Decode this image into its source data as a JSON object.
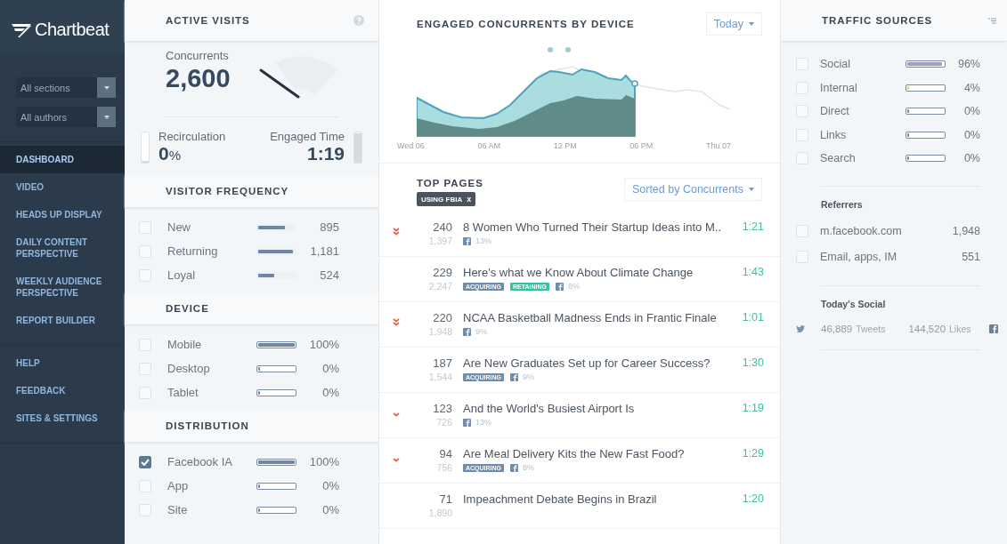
{
  "sidebar": {
    "logo": "Chartbeat",
    "filters": [
      {
        "value": "All sections"
      },
      {
        "value": "All authors"
      }
    ],
    "nav_groups": [
      [
        {
          "label": "DASHBOARD",
          "selected": true
        },
        {
          "label": "VIDEO",
          "selected": false
        },
        {
          "label": "HEADS UP DISPLAY",
          "selected": false
        },
        {
          "label": "DAILY CONTENT PERSPECTIVE",
          "selected": false
        },
        {
          "label": "WEEKLY AUDIENCE PERSPECTIVE",
          "selected": false
        },
        {
          "label": "REPORT BUILDER",
          "selected": false
        }
      ],
      [
        {
          "label": "HELP",
          "selected": false
        },
        {
          "label": "FEEDBACK",
          "selected": false
        },
        {
          "label": "SITES & SETTINGS",
          "selected": false
        }
      ]
    ]
  },
  "active_visits": {
    "title": "ACTIVE VISITS",
    "concurrents_label": "Concurrents",
    "concurrents": "2,600",
    "recirculation_label": "Recirculation",
    "recirculation_value": "0",
    "recirculation_unit": "%",
    "recirculation_meter": {
      "level": 0
    },
    "engaged_time_label": "Engaged Time",
    "engaged_time": "1:19",
    "engaged_meter": {
      "level": 0.95
    }
  },
  "sections": [
    {
      "title": "VISITOR FREQUENCY",
      "kind": "plain",
      "rows": [
        {
          "label": "New",
          "checked": false,
          "level": 0.73,
          "value": "895"
        },
        {
          "label": "Returning",
          "checked": false,
          "level": 0.96,
          "value": "1,181"
        },
        {
          "label": "Loyal",
          "checked": false,
          "level": 0.43,
          "value": "524"
        }
      ]
    },
    {
      "title": "DEVICE",
      "kind": "track",
      "rows": [
        {
          "label": "Mobile",
          "checked": false,
          "level": 1,
          "value": "100%"
        },
        {
          "label": "Desktop",
          "checked": false,
          "level": 0,
          "value": "0%"
        },
        {
          "label": "Tablet",
          "checked": false,
          "level": 0,
          "value": "0%"
        }
      ]
    },
    {
      "title": "DISTRIBUTION",
      "kind": "track",
      "rows": [
        {
          "label": "Facebook IA",
          "checked": true,
          "level": 1,
          "value": "100%"
        },
        {
          "label": "App",
          "checked": false,
          "level": 0,
          "value": "0%"
        },
        {
          "label": "Site",
          "checked": false,
          "level": 0,
          "value": "0%"
        }
      ]
    }
  ],
  "engaged_chart": {
    "title": "ENGAGED CONCURRENTS BY DEVICE",
    "range": "Today",
    "x_labels": [
      "Wed 06",
      "06 AM",
      "12 PM",
      "06 PM",
      "Thu 07"
    ]
  },
  "top_pages": {
    "title": "TOP PAGES",
    "sort": "Sorted by Concurrents",
    "filter_chip": "USING FBIA",
    "chip_close": "x",
    "rows": [
      {
        "kind": "double-down",
        "concurrents": "240",
        "total": "1,397",
        "title": "8 Women Who Turned Their Startup Ideas into M..",
        "tags": [],
        "facebook": "13%",
        "time": "1:21"
      },
      {
        "kind": "plain",
        "concurrents": "229",
        "total": "2,247",
        "title": "Here's what we Know About Climate Change",
        "tags": [
          {
            "label": "ACQUIRING",
            "kind": "acquiring"
          },
          {
            "label": "RETAINING",
            "kind": "retaining"
          }
        ],
        "facebook": "8%",
        "time": "1:43"
      },
      {
        "kind": "double-down",
        "concurrents": "220",
        "total": "1,948",
        "title": "NCAA Basketball Madness Ends in Frantic Finale",
        "tags": [],
        "facebook": "9%",
        "time": "1:01"
      },
      {
        "kind": "plain",
        "concurrents": "187",
        "total": "1,544",
        "title": "Are New Graduates Set up for Career Success?",
        "tags": [
          {
            "label": "ACQUIRING",
            "kind": "acquiring"
          }
        ],
        "facebook": "9%",
        "time": "1:30"
      },
      {
        "kind": "down",
        "concurrents": "123",
        "total": "726",
        "title": "And the World's Busiest Airport Is",
        "tags": [],
        "facebook": "13%",
        "time": "1:19"
      },
      {
        "kind": "down",
        "concurrents": "94",
        "total": "756",
        "title": "Are Meal Delivery Kits the New Fast Food?",
        "tags": [
          {
            "label": "ACQUIRING",
            "kind": "acquiring"
          }
        ],
        "facebook": "8%",
        "time": "1:29"
      },
      {
        "kind": "plain",
        "concurrents": "71",
        "total": "1,890",
        "title": "Impeachment Debate Begins in Brazil",
        "tags": [],
        "facebook": null,
        "time": "1:20"
      }
    ]
  },
  "traffic_sources": {
    "title": "TRAFFIC SOURCES",
    "rows": [
      {
        "label": "Social",
        "checked": false,
        "level": 0.96,
        "value": "96%",
        "color": "#a09ccc"
      },
      {
        "label": "Internal",
        "checked": false,
        "level": 0.04,
        "value": "4%",
        "color": "#e8c87a"
      },
      {
        "label": "Direct",
        "checked": false,
        "level": 0,
        "value": "0%"
      },
      {
        "label": "Links",
        "checked": false,
        "level": 0,
        "value": "0%"
      },
      {
        "label": "Search",
        "checked": false,
        "level": 0,
        "value": "0%"
      }
    ],
    "referrers_title": "Referrers",
    "referrers": [
      {
        "label": "m.facebook.com",
        "checked": false,
        "value": "1,948"
      },
      {
        "label": "Email, apps, IM",
        "checked": false,
        "value": "551"
      }
    ],
    "social_title": "Today's Social",
    "tweets": "46,889",
    "tweets_label": "Tweets",
    "likes": "144,520",
    "likes_label": "Likes"
  }
}
